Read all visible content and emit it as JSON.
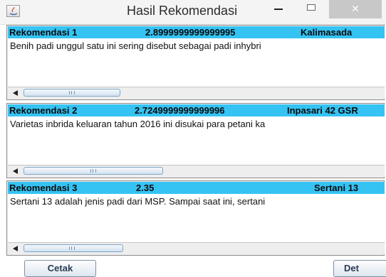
{
  "window": {
    "title": "Hasil Rekomendasi",
    "minimize_symbol": "–",
    "maximize_symbol": "□",
    "close_symbol": "✕"
  },
  "recommendations": [
    {
      "label": "Rekomendasi 1",
      "score": "2.8999999999999995",
      "variety": "Kalimasada",
      "description": "Benih padi unggul satu ini sering disebut sebagai padi inhybri"
    },
    {
      "label": "Rekomendasi 2",
      "score": "2.7249999999999996",
      "variety": "Inpasari 42 GSR",
      "description": "Varietas inbrida keluaran tahun 2016 ini disukai para petani ka"
    },
    {
      "label": "Rekomendasi 3",
      "score": "2.35",
      "variety": "Sertani 13",
      "description": "Sertani 13 adalah jenis padi dari MSP. Sampai saat ini, sertani"
    }
  ],
  "buttons": {
    "print_label": "Cetak",
    "detail_label": "Det"
  },
  "colors": {
    "header_bg": "#35c3f3",
    "panel_bg": "#eeeeee"
  }
}
